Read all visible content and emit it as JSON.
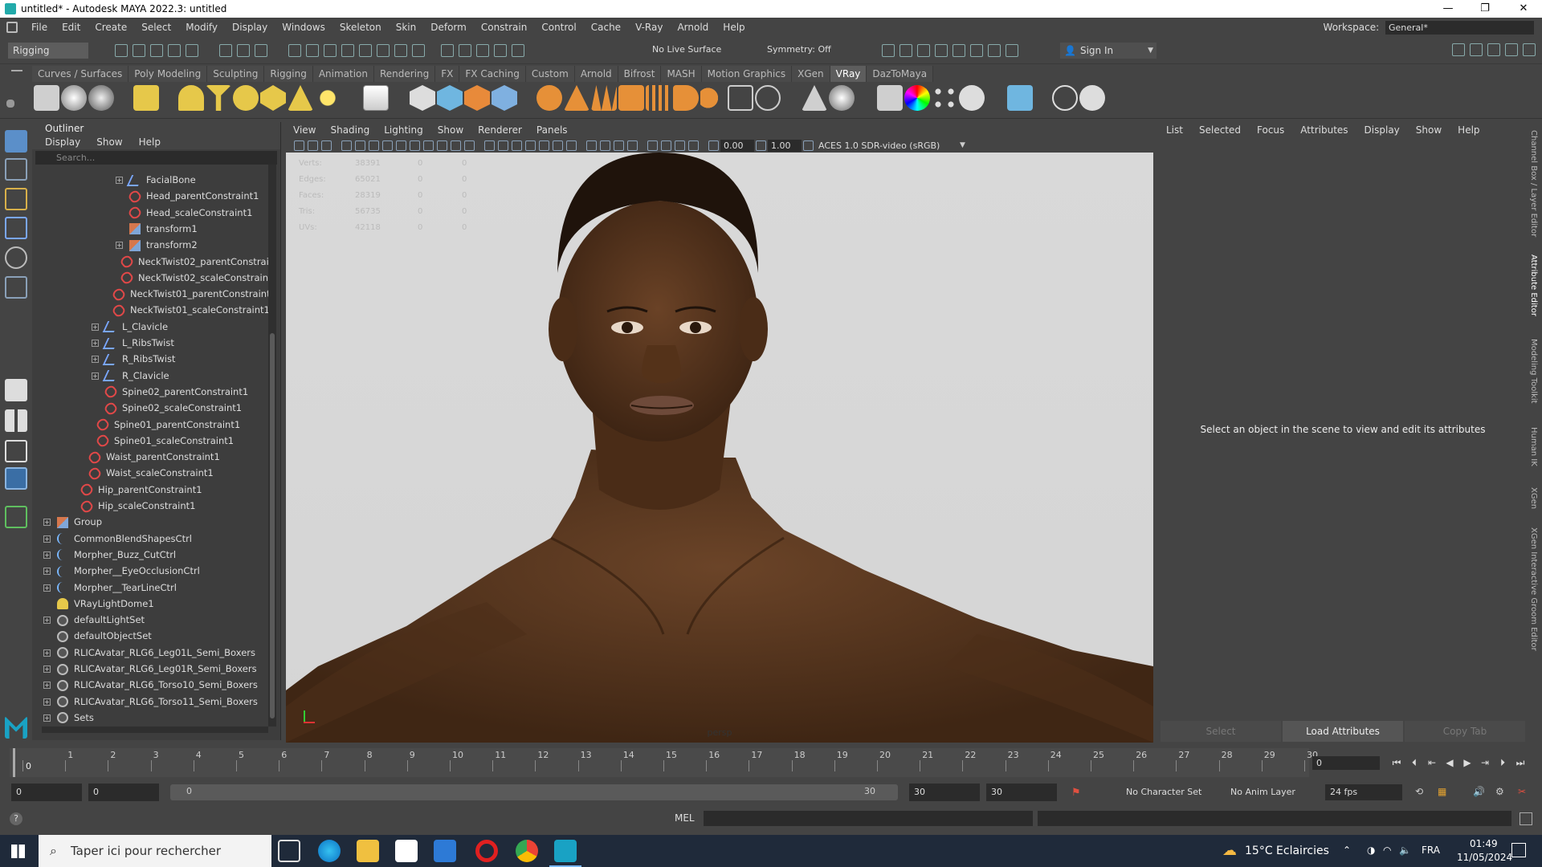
{
  "window": {
    "title": "untitled* - Autodesk MAYA 2022.3: untitled",
    "min": "—",
    "max": "❐",
    "close": "✕"
  },
  "menubar": [
    "File",
    "Edit",
    "Create",
    "Select",
    "Modify",
    "Display",
    "Windows",
    "Skeleton",
    "Skin",
    "Deform",
    "Constrain",
    "Control",
    "Cache",
    "V-Ray",
    "Arnold",
    "Help"
  ],
  "workspace": {
    "label": "Workspace:",
    "value": "General*"
  },
  "statusline": {
    "menuset": "Rigging",
    "live_surface": "No Live Surface",
    "symmetry": "Symmetry: Off",
    "sign_in": "Sign In"
  },
  "shelf_tabs": [
    "Curves / Surfaces",
    "Poly Modeling",
    "Sculpting",
    "Rigging",
    "Animation",
    "Rendering",
    "FX",
    "FX Caching",
    "Custom",
    "Arnold",
    "Bifrost",
    "MASH",
    "Motion Graphics",
    "XGen",
    "VRay",
    "DazToMaya"
  ],
  "shelf_active": "VRay",
  "outliner": {
    "title": "Outliner",
    "menu": [
      "Display",
      "Show",
      "Help"
    ],
    "search_placeholder": "Search...",
    "nodes": [
      {
        "label": "FacialBone",
        "type": "joint",
        "expand": "+"
      },
      {
        "label": "Head_parentConstraint1",
        "type": "constraint",
        "expand": ""
      },
      {
        "label": "Head_scaleConstraint1",
        "type": "constraint",
        "expand": ""
      },
      {
        "label": "transform1",
        "type": "transform",
        "expand": ""
      },
      {
        "label": "transform2",
        "type": "transform",
        "expand": "+"
      },
      {
        "label": "NeckTwist02_parentConstrai",
        "type": "constraint",
        "expand": ""
      },
      {
        "label": "NeckTwist02_scaleConstraint",
        "type": "constraint",
        "expand": ""
      },
      {
        "label": "NeckTwist01_parentConstraint",
        "type": "constraint",
        "expand": ""
      },
      {
        "label": "NeckTwist01_scaleConstraint1",
        "type": "constraint",
        "expand": ""
      },
      {
        "label": "L_Clavicle",
        "type": "joint",
        "expand": "+"
      },
      {
        "label": "L_RibsTwist",
        "type": "joint",
        "expand": "+"
      },
      {
        "label": "R_RibsTwist",
        "type": "joint",
        "expand": "+"
      },
      {
        "label": "R_Clavicle",
        "type": "joint",
        "expand": "+"
      },
      {
        "label": "Spine02_parentConstraint1",
        "type": "constraint",
        "expand": ""
      },
      {
        "label": "Spine02_scaleConstraint1",
        "type": "constraint",
        "expand": ""
      },
      {
        "label": "Spine01_parentConstraint1",
        "type": "constraint",
        "expand": ""
      },
      {
        "label": "Spine01_scaleConstraint1",
        "type": "constraint",
        "expand": ""
      },
      {
        "label": "Waist_parentConstraint1",
        "type": "constraint",
        "expand": ""
      },
      {
        "label": "Waist_scaleConstraint1",
        "type": "constraint",
        "expand": ""
      },
      {
        "label": "Hip_parentConstraint1",
        "type": "constraint",
        "expand": ""
      },
      {
        "label": "Hip_scaleConstraint1",
        "type": "constraint",
        "expand": ""
      },
      {
        "label": "Group",
        "type": "transform",
        "expand": "+"
      },
      {
        "label": "CommonBlendShapesCtrl",
        "type": "curve",
        "expand": "+"
      },
      {
        "label": "Morpher_Buzz_CutCtrl",
        "type": "curve",
        "expand": "+"
      },
      {
        "label": "Morpher__EyeOcclusionCtrl",
        "type": "curve",
        "expand": "+"
      },
      {
        "label": "Morpher__TearLineCtrl",
        "type": "curve",
        "expand": "+"
      },
      {
        "label": "VRayLightDome1",
        "type": "light",
        "expand": ""
      },
      {
        "label": "defaultLightSet",
        "type": "set",
        "expand": "+"
      },
      {
        "label": "defaultObjectSet",
        "type": "set",
        "expand": ""
      },
      {
        "label": "RLICAvatar_RLG6_Leg01L_Semi_Boxers",
        "type": "set",
        "expand": "+"
      },
      {
        "label": "RLICAvatar_RLG6_Leg01R_Semi_Boxers",
        "type": "set",
        "expand": "+"
      },
      {
        "label": "RLICAvatar_RLG6_Torso10_Semi_Boxers",
        "type": "set",
        "expand": "+"
      },
      {
        "label": "RLICAvatar_RLG6_Torso11_Semi_Boxers",
        "type": "set",
        "expand": "+"
      },
      {
        "label": "Sets",
        "type": "set",
        "expand": "+"
      }
    ]
  },
  "viewport": {
    "menu": [
      "View",
      "Shading",
      "Lighting",
      "Show",
      "Renderer",
      "Panels"
    ],
    "exposure": "0.00",
    "gamma": "1.00",
    "colorspace": "ACES 1.0 SDR-video (sRGB)",
    "camera": "persp",
    "hud": [
      {
        "k": "Verts:",
        "v": "38391",
        "a": "0",
        "b": "0"
      },
      {
        "k": "Edges:",
        "v": "65021",
        "a": "0",
        "b": "0"
      },
      {
        "k": "Faces:",
        "v": "28319",
        "a": "0",
        "b": "0"
      },
      {
        "k": "Tris:",
        "v": "56735",
        "a": "0",
        "b": "0"
      },
      {
        "k": "UVs:",
        "v": "42118",
        "a": "0",
        "b": "0"
      }
    ]
  },
  "attribute_editor": {
    "menu": [
      "List",
      "Selected",
      "Focus",
      "Attributes",
      "Display",
      "Show",
      "Help"
    ],
    "message": "Select an object in the scene to view and edit its attributes",
    "buttons": [
      "Select",
      "Load Attributes",
      "Copy Tab"
    ]
  },
  "side_tabs": [
    "Channel Box / Layer Editor",
    "Attribute Editor",
    "Modeling Toolkit",
    "Human IK",
    "XGen",
    "XGen Interactive Groom Editor"
  ],
  "timeslider": {
    "ticks": [
      "0",
      "1",
      "2",
      "3",
      "4",
      "5",
      "6",
      "7",
      "8",
      "9",
      "10",
      "11",
      "12",
      "13",
      "14",
      "15",
      "16",
      "17",
      "18",
      "19",
      "20",
      "21",
      "22",
      "23",
      "24",
      "25",
      "26",
      "27",
      "28",
      "29",
      "30"
    ],
    "current_frame": "0",
    "start_marker": "0"
  },
  "range": {
    "start": "0",
    "inner_start": "0",
    "slider_start": "0",
    "slider_end": "30",
    "inner_end": "30",
    "end": "30",
    "character_set": "No Character Set",
    "anim_layer": "No Anim Layer",
    "fps": "24 fps"
  },
  "cmdline": {
    "label": "MEL",
    "help": "?"
  },
  "taskbar": {
    "search_placeholder": "Taper ici pour rechercher",
    "weather": "15°C  Eclaircies",
    "lang": "FRA",
    "time": "01:49",
    "date": "11/05/2024"
  },
  "colors": {
    "selected_tab": "#5d5d5d",
    "constraint": "#e04848",
    "joint": "#7aa7ff",
    "maya_blue": "#19a2c4",
    "viewport_bg": "#d7d7d7",
    "skin": "#5a3820"
  }
}
